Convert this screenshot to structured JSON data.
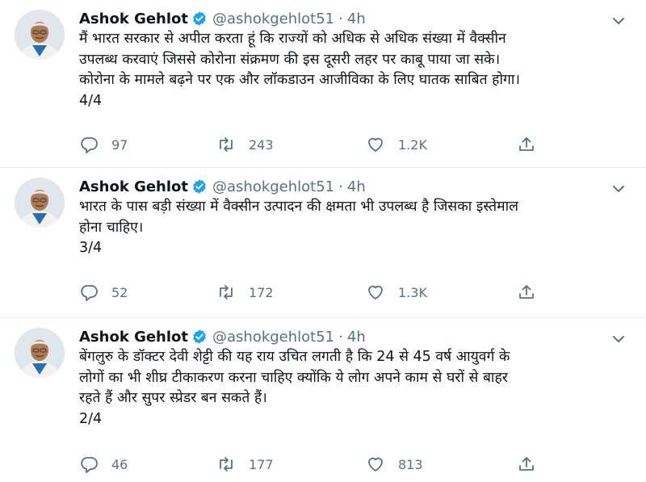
{
  "tweets": [
    {
      "name": "Ashok Gehlot",
      "handle": "@ashokgehlot51",
      "separator": "·",
      "time": "4h",
      "lines": [
        "मैं भारत सरकार से अपील करता हूं कि राज्यों को अधिक से अधिक संख्या में वैक्सीन",
        "उपलब्ध करवाएं जिससे कोरोना संक्रमण की इस दूसरी लहर पर काबू पाया जा सके।",
        "कोरोना के मामले बढ़ने पर एक और लॉकडाउन आजीविका के लिए घातक साबित होगा।",
        "4/4"
      ],
      "replies": "97",
      "retweets": "243",
      "likes": "1.2K"
    },
    {
      "name": "Ashok Gehlot",
      "handle": "@ashokgehlot51",
      "separator": "·",
      "time": "4h",
      "lines": [
        "भारत के पास बड़ी संख्या में वैक्सीन उत्पादन की क्षमता भी उपलब्ध है जिसका इस्तेमाल",
        "होना चाहिए।",
        "3/4"
      ],
      "replies": "52",
      "retweets": "172",
      "likes": "1.3K"
    },
    {
      "name": "Ashok Gehlot",
      "handle": "@ashokgehlot51",
      "separator": "·",
      "time": "4h",
      "lines": [
        "बेंगलुरु के डॉक्टर देवी शेट्टी की यह राय उचित लगती है कि 24 से 45  वर्ष आयुवर्ग के",
        "लोगों का भी शीघ्र टीकाकरण करना चाहिए क्योंकि ये लोग अपने काम से घरों से बाहर",
        "रहते हैं और सुपर स्प्रेडर बन सकते हैं।",
        "2/4"
      ],
      "replies": "46",
      "retweets": "177",
      "likes": "813"
    }
  ],
  "icons": {
    "verified": "verified-badge-icon",
    "more": "chevron-down-icon",
    "reply": "reply-icon",
    "retweet": "retweet-icon",
    "like": "heart-icon",
    "share": "share-icon"
  },
  "colors": {
    "text": "#0f1419",
    "secondary": "#5b7083",
    "verified": "#1da1f2",
    "divider": "#e6ecf0"
  }
}
